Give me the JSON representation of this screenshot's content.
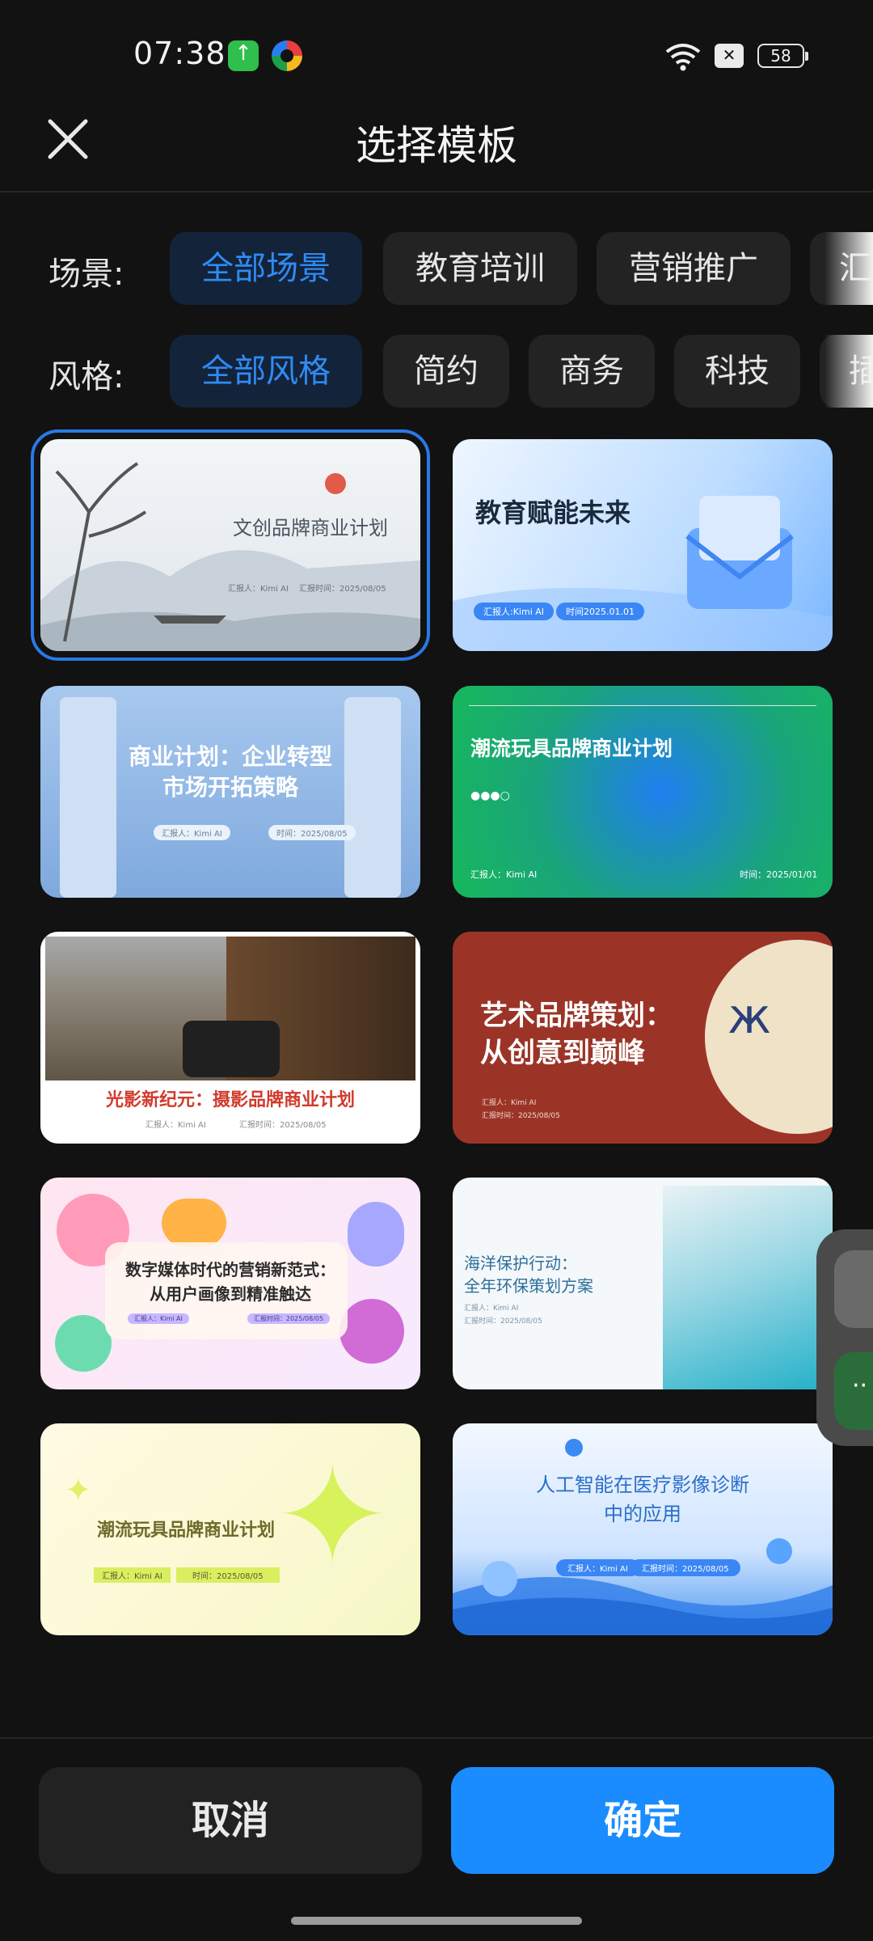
{
  "status_bar": {
    "time": "07:38",
    "battery": "58"
  },
  "header": {
    "title": "选择模板"
  },
  "filters": {
    "scene_label": "场景:",
    "scene_options": [
      "全部场景",
      "教育培训",
      "营销推广",
      "汇"
    ],
    "style_label": "风格:",
    "style_options": [
      "全部风格",
      "简约",
      "商务",
      "科技",
      "插"
    ]
  },
  "templates": [
    {
      "title": "文创品牌商业计划",
      "meta1": "汇报人：Kimi AI",
      "meta2": "汇报时间：2025/08/05"
    },
    {
      "title": "教育赋能未来",
      "meta1": "汇报人:Kimi AI",
      "meta2": "时间2025.01.01"
    },
    {
      "title": "商业计划：企业转型",
      "title2": "市场开拓策略",
      "meta1": "汇报人：Kimi AI",
      "meta2": "时间：2025/08/05"
    },
    {
      "title": "潮流玩具品牌商业计划",
      "meta1": "汇报人：Kimi AI",
      "meta2": "时间：2025/01/01"
    },
    {
      "title": "光影新纪元：摄影品牌商业计划",
      "meta1": "汇报人：Kimi AI",
      "meta2": "汇报时间：2025/08/05"
    },
    {
      "title": "艺术品牌策划：",
      "title2": "从创意到巅峰",
      "meta1": "汇报人：Kimi AI",
      "meta2": "汇报时间：2025/08/05"
    },
    {
      "title": "数字媒体时代的营销新范式：",
      "title2": "从用户画像到精准触达",
      "meta1": "汇报人：Kimi AI",
      "meta2": "汇报时间：2025/08/05"
    },
    {
      "title": "海洋保护行动：",
      "title2": "全年环保策划方案",
      "meta1": "汇报人：Kimi AI",
      "meta2": "汇报时间：2025/08/05"
    },
    {
      "title": "潮流玩具品牌商业计划",
      "meta1": "汇报人：Kimi AI",
      "meta2": "时间：2025/08/05"
    },
    {
      "title": "人工智能在医疗影像诊断",
      "title2": "中的应用",
      "meta1": "汇报人：Kimi AI",
      "meta2": "汇报时间：2025/08/05"
    }
  ],
  "buttons": {
    "cancel": "取消",
    "confirm": "确定"
  },
  "colors": {
    "accent": "#1a8cff",
    "selected_outline": "#2979e6",
    "background": "#121212"
  }
}
